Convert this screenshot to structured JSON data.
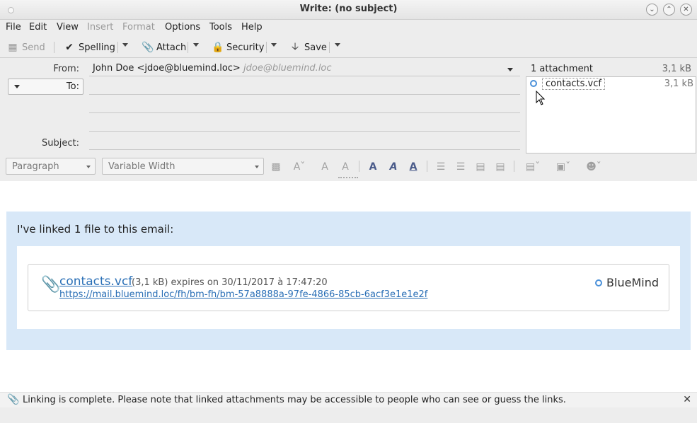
{
  "window": {
    "title": "Write: (no subject)"
  },
  "menu": {
    "file": "File",
    "edit": "Edit",
    "view": "View",
    "insert": "Insert",
    "format": "Format",
    "options": "Options",
    "tools": "Tools",
    "help": "Help"
  },
  "toolbar": {
    "send": "Send",
    "spelling": "Spelling",
    "attach": "Attach",
    "security": "Security",
    "save": "Save"
  },
  "header": {
    "from_label": "From:",
    "from_value": "John Doe <jdoe@bluemind.loc>",
    "from_placeholder": "jdoe@bluemind.loc",
    "to_label": "To:",
    "subject_label": "Subject:"
  },
  "attachments": {
    "count_label": "1 attachment",
    "total_size": "3,1 kB",
    "items": [
      {
        "name": "contacts.vcf",
        "size": "3,1 kB"
      }
    ]
  },
  "format": {
    "paragraph": "Paragraph",
    "font": "Variable Width"
  },
  "body": {
    "intro": "I've linked 1 file to this email:",
    "file_name": "contacts.vcf",
    "file_meta": "(3,1 kB) expires on 30/11/2017 à 17:47:20",
    "file_url": "https://mail.bluemind.loc/fh/bm-fh/bm-57a8888a-97fe-4866-85cb-6acf3e1e1e2f",
    "brand": "BlueMind"
  },
  "notification": {
    "message": "Linking is complete. Please note that linked attachments may be accessible to people who can see or guess the links."
  },
  "colors": {
    "accent": "#4a90d9",
    "link_box_bg": "#d8e8f8",
    "link": "#2a6fb6"
  }
}
